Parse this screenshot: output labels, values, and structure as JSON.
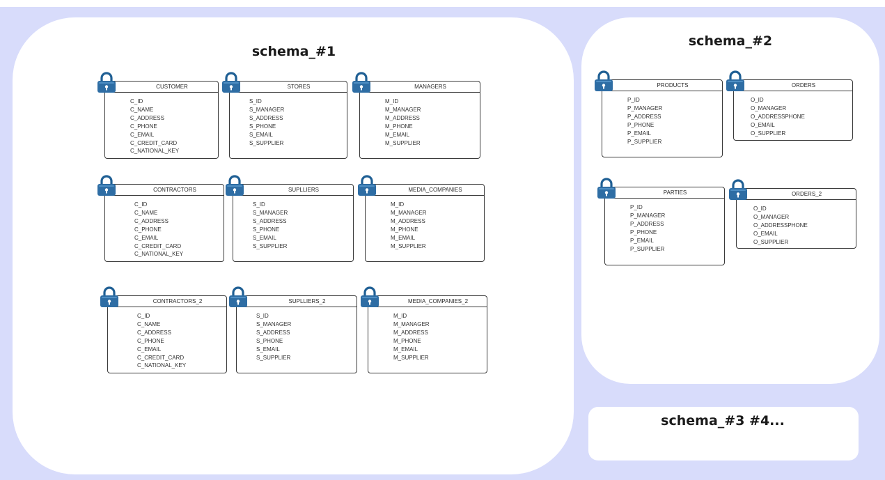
{
  "schemas": [
    {
      "title": "schema_#1",
      "tables": [
        {
          "name": "CUSTOMER",
          "fields": [
            "C_ID",
            "C_NAME",
            "C_ADDRESS",
            "C_PHONE",
            "C_EMAIL",
            "C_CREDIT_CARD",
            "C_NATIONAL_KEY"
          ]
        },
        {
          "name": "STORES",
          "fields": [
            "S_ID",
            "S_MANAGER",
            "S_ADDRESS",
            "S_PHONE",
            "S_EMAIL",
            "S_SUPPLIER"
          ]
        },
        {
          "name": "MANAGERS",
          "fields": [
            "M_ID",
            "M_MANAGER",
            "M_ADDRESS",
            "M_PHONE",
            "M_EMAIL",
            "M_SUPPLIER"
          ]
        },
        {
          "name": "CONTRACTORS",
          "fields": [
            "C_ID",
            "C_NAME",
            "C_ADDRESS",
            "C_PHONE",
            "C_EMAIL",
            "C_CREDIT_CARD",
            "C_NATIONAL_KEY"
          ]
        },
        {
          "name": "SUPLLIERS",
          "fields": [
            "S_ID",
            "S_MANAGER",
            "S_ADDRESS",
            "S_PHONE",
            "S_EMAIL",
            "S_SUPPLIER"
          ]
        },
        {
          "name": "MEDIA_COMPANIES",
          "fields": [
            "M_ID",
            "M_MANAGER",
            "M_ADDRESS",
            "M_PHONE",
            "M_EMAIL",
            "M_SUPPLIER"
          ]
        },
        {
          "name": "CONTRACTORS_2",
          "fields": [
            "C_ID",
            "C_NAME",
            "C_ADDRESS",
            "C_PHONE",
            "C_EMAIL",
            "C_CREDIT_CARD",
            "C_NATIONAL_KEY"
          ]
        },
        {
          "name": "SUPLLIERS_2",
          "fields": [
            "S_ID",
            "S_MANAGER",
            "S_ADDRESS",
            "S_PHONE",
            "S_EMAIL",
            "S_SUPPLIER"
          ]
        },
        {
          "name": "MEDIA_COMPANIES_2",
          "fields": [
            "M_ID",
            "M_MANAGER",
            "M_ADDRESS",
            "M_PHONE",
            "M_EMAIL",
            "M_SUPPLIER"
          ]
        }
      ]
    },
    {
      "title": "schema_#2",
      "tables": [
        {
          "name": "PRODUCTS",
          "fields": [
            "P_ID",
            "P_MANAGER",
            "P_ADDRESS",
            "P_PHONE",
            "P_EMAIL",
            "P_SUPPLIER"
          ]
        },
        {
          "name": "ORDERS",
          "fields": [
            "O_ID",
            "O_MANAGER",
            "O_ADDRESSPHONE",
            "O_EMAIL",
            "O_SUPPLIER"
          ]
        },
        {
          "name": "PARTIES",
          "fields": [
            "P_ID",
            "P_MANAGER",
            "P_ADDRESS",
            "P_PHONE",
            "P_EMAIL",
            "P_SUPPLIER"
          ]
        },
        {
          "name": "ORDERS_2",
          "fields": [
            "O_ID",
            "O_MANAGER",
            "O_ADDRESSPHONE",
            "O_EMAIL",
            "O_SUPPLIER"
          ]
        }
      ]
    },
    {
      "title": "schema_#3 #4...",
      "tables": []
    }
  ],
  "colors": {
    "background": "#d8dcfb",
    "panel": "#ffffff",
    "lock_body": "#2e6da4",
    "lock_shackle": "#1f5f94",
    "table_border": "#3a3a3a"
  },
  "icons": {
    "table_lock": "padlock-icon"
  }
}
